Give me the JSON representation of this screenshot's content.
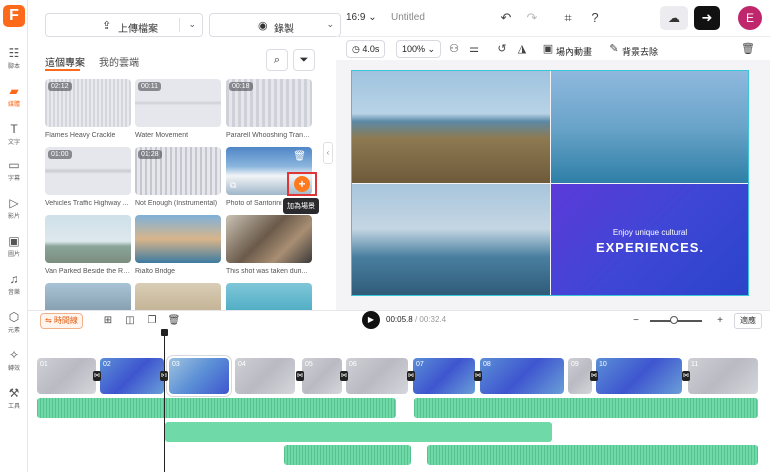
{
  "app": {
    "logo": "F"
  },
  "rail": [
    {
      "label": "腳本",
      "icon": "script-icon"
    },
    {
      "label": "媒體",
      "icon": "media-icon"
    },
    {
      "label": "文字",
      "icon": "text-icon"
    },
    {
      "label": "字幕",
      "icon": "subtitle-icon"
    },
    {
      "label": "影片",
      "icon": "video-icon"
    },
    {
      "label": "圖片",
      "icon": "image-icon"
    },
    {
      "label": "音樂",
      "icon": "music-icon"
    },
    {
      "label": "元素",
      "icon": "elements-icon"
    },
    {
      "label": "轉效",
      "icon": "transition-icon"
    },
    {
      "label": "工具",
      "icon": "tools-icon"
    }
  ],
  "panel": {
    "upload_label": "上傳檔案",
    "record_label": "錄製",
    "tabs": [
      "這個專案",
      "我的雲端"
    ],
    "items": [
      {
        "caption": "Flames Heavy Crackle",
        "duration": "02:12"
      },
      {
        "caption": "Water Movement",
        "duration": "00:11"
      },
      {
        "caption": "Pararell Whooshing Trans...",
        "duration": "00:18"
      },
      {
        "caption": "Vehicles Traffic Highway ...",
        "duration": "01:00"
      },
      {
        "caption": "Not Enough (Instrumental)",
        "duration": "01:28"
      },
      {
        "caption": "Photo of Santorini ...",
        "duration": ""
      },
      {
        "caption": "Van Parked Beside the Ro...",
        "duration": ""
      },
      {
        "caption": "Rialto Bridge",
        "duration": ""
      },
      {
        "caption": "This shot was taken duri...",
        "duration": ""
      }
    ],
    "add_tooltip": "加為場景"
  },
  "topbar": {
    "ratio": "16:9",
    "title": "Untitled"
  },
  "subbar": {
    "duration": "4.0s",
    "zoom": "100%",
    "animation_label": "場內動畫",
    "remove_bg_label": "背景去除"
  },
  "canvas": {
    "headline_small": "Enjoy unique cultural",
    "headline_big": "EXPERIENCES."
  },
  "timeline": {
    "mode_label": "時間線",
    "current_time": "00:05.8",
    "total_time": "/ 00:32.4",
    "fit_label": "適應",
    "clips": [
      "01",
      "02",
      "03",
      "04",
      "05",
      "06",
      "07",
      "08",
      "09",
      "10",
      "11"
    ]
  }
}
